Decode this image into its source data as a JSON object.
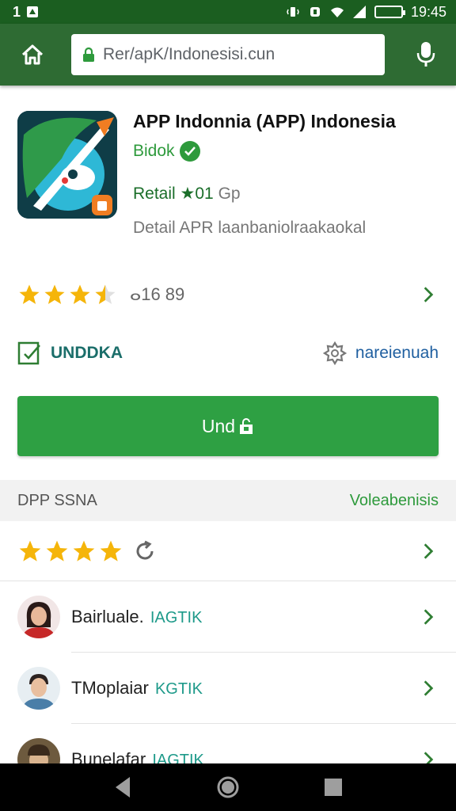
{
  "status_bar": {
    "left_text": "1",
    "time": "19:45",
    "icons": [
      "notification-icon",
      "vibrate-icon",
      "alarm-icon",
      "wifi-icon",
      "signal-icon",
      "battery-icon"
    ]
  },
  "toolbar": {
    "url": "Rer/apK/Indonesisi.cun",
    "icons": [
      "home-icon",
      "lock-icon",
      "mic-icon"
    ]
  },
  "app": {
    "title": "APP Indonnia (APP) Indonesia",
    "developer": "Bidok",
    "meta_label": "Retail ★01",
    "meta_size": "Gp",
    "description": "Detail APR laanbaniolraakaokal"
  },
  "rating": {
    "stars": 3.5,
    "count": "ⴰ16 89"
  },
  "actions": {
    "install_link": "UNDDKA",
    "wishlist": "nareienuah"
  },
  "main_button": {
    "label": "Und"
  },
  "reviews_section": {
    "title": "DPP SSNA",
    "link": "Voleabenisis",
    "summary_stars": 4,
    "items": [
      {
        "name": "Bairluale.",
        "tag": "IAGTIK"
      },
      {
        "name": "TMoplaiar",
        "tag": "KGTIK"
      },
      {
        "name": "Bunelafar",
        "tag": "IAGTIK"
      }
    ]
  },
  "colors": {
    "status_bar": "#1b5e20",
    "toolbar": "#2e6b33",
    "accent_green": "#2ea043",
    "star": "#f5b50a"
  }
}
